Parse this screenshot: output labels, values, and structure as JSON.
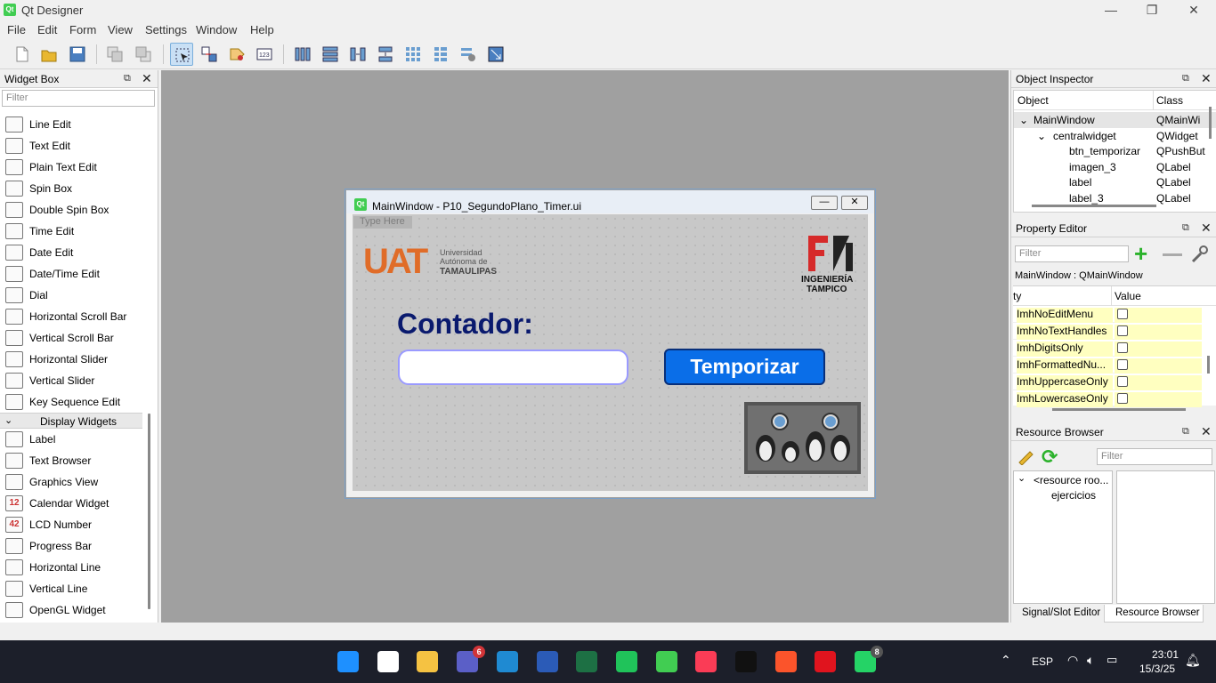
{
  "app": {
    "title": "Qt Designer",
    "icon": "qt-logo-icon"
  },
  "menu": [
    "File",
    "Edit",
    "Form",
    "View",
    "Settings",
    "Window",
    "Help"
  ],
  "widget_box": {
    "title": "Widget Box",
    "filter_placeholder": "Filter",
    "items": [
      {
        "label": "Line Edit",
        "icon": "line-edit-icon"
      },
      {
        "label": "Text Edit",
        "icon": "text-edit-icon"
      },
      {
        "label": "Plain Text Edit",
        "icon": "plain-text-edit-icon"
      },
      {
        "label": "Spin Box",
        "icon": "spin-box-icon"
      },
      {
        "label": "Double Spin Box",
        "icon": "double-spin-box-icon"
      },
      {
        "label": "Time Edit",
        "icon": "clock-icon"
      },
      {
        "label": "Date Edit",
        "icon": "calendar-icon"
      },
      {
        "label": "Date/Time Edit",
        "icon": "datetime-icon"
      },
      {
        "label": "Dial",
        "icon": "dial-icon"
      },
      {
        "label": "Horizontal Scroll Bar",
        "icon": "hscrollbar-icon"
      },
      {
        "label": "Vertical Scroll Bar",
        "icon": "vscrollbar-icon"
      },
      {
        "label": "Horizontal Slider",
        "icon": "hslider-icon"
      },
      {
        "label": "Vertical Slider",
        "icon": "vslider-icon"
      },
      {
        "label": "Key Sequence Edit",
        "icon": "key-sequence-icon"
      }
    ],
    "category": "Display Widgets",
    "display_items": [
      {
        "label": "Label",
        "icon": "label-tag-icon"
      },
      {
        "label": "Text Browser",
        "icon": "text-browser-icon"
      },
      {
        "label": "Graphics View",
        "icon": "graphics-view-icon"
      },
      {
        "label": "Calendar Widget",
        "icon": "calendar-widget-icon",
        "glyph": "12"
      },
      {
        "label": "LCD Number",
        "icon": "lcd-number-icon",
        "glyph": "42"
      },
      {
        "label": "Progress Bar",
        "icon": "progress-bar-icon"
      },
      {
        "label": "Horizontal Line",
        "icon": "hline-icon"
      },
      {
        "label": "Vertical Line",
        "icon": "vline-icon"
      },
      {
        "label": "OpenGL Widget",
        "icon": "opengl-icon"
      }
    ]
  },
  "form_window": {
    "title": "MainWindow - P10_SegundoPlano_Timer.ui",
    "type_here": "Type Here",
    "uat_logo": {
      "big": "UAT",
      "lines": [
        "Universidad",
        "Autónoma de",
        "TAMAULIPAS"
      ]
    },
    "fi_logo": {
      "lines": [
        "INGENIERÍA",
        "TAMPICO"
      ]
    },
    "contador_label": "Contador:",
    "line_edit_value": "",
    "button_label": "Temporizar"
  },
  "object_inspector": {
    "title": "Object Inspector",
    "columns": [
      "Object",
      "Class"
    ],
    "rows": [
      {
        "object": "MainWindow",
        "class": "QMainWi",
        "level": 0,
        "expander": "⌄"
      },
      {
        "object": "centralwidget",
        "class": "QWidget",
        "level": 1,
        "expander": "⌄"
      },
      {
        "object": "btn_temporizar",
        "class": "QPushBut",
        "level": 2,
        "expander": ""
      },
      {
        "object": "imagen_3",
        "class": "QLabel",
        "level": 2,
        "expander": ""
      },
      {
        "object": "label",
        "class": "QLabel",
        "level": 2,
        "expander": ""
      },
      {
        "object": "label_3",
        "class": "QLabel",
        "level": 2,
        "expander": ""
      }
    ]
  },
  "property_editor": {
    "title": "Property Editor",
    "filter_placeholder": "Filter",
    "context": "MainWindow : QMainWindow",
    "columns": [
      "ty",
      "Value"
    ],
    "rows": [
      {
        "name": "ImhNoEditMenu",
        "checked": false
      },
      {
        "name": "ImhNoTextHandles",
        "checked": false
      },
      {
        "name": "ImhDigitsOnly",
        "checked": false
      },
      {
        "name": "ImhFormattedNu...",
        "checked": false
      },
      {
        "name": "ImhUppercaseOnly",
        "checked": false
      },
      {
        "name": "ImhLowercaseOnly",
        "checked": false
      }
    ]
  },
  "resource_browser": {
    "title": "Resource Browser",
    "filter_placeholder": "Filter",
    "tree": [
      "<resource roo...",
      "ejercicios"
    ]
  },
  "bottom_tabs": [
    "Signal/Slot Editor",
    "Resource Browser"
  ],
  "taskbar": {
    "apps": [
      {
        "name": "windows-start-icon",
        "color": "#1e90ff"
      },
      {
        "name": "search-icon",
        "color": "#ffffff"
      },
      {
        "name": "file-explorer-icon",
        "color": "#f5c242"
      },
      {
        "name": "teams-icon",
        "color": "#5b5fc7",
        "badge": "6"
      },
      {
        "name": "vscode-icon",
        "color": "#1f8ad2"
      },
      {
        "name": "word-icon",
        "color": "#2b5bb7"
      },
      {
        "name": "excel-icon",
        "color": "#1d7044"
      },
      {
        "name": "pycharm-icon",
        "color": "#20c35a"
      },
      {
        "name": "qt-designer-icon",
        "color": "#41cd52"
      },
      {
        "name": "apple-music-icon",
        "color": "#fa3c56"
      },
      {
        "name": "apple-tv-icon",
        "color": "#111111"
      },
      {
        "name": "brave-icon",
        "color": "#fb542b"
      },
      {
        "name": "opera-icon",
        "color": "#e0141e"
      },
      {
        "name": "whatsapp-icon",
        "color": "#25d366",
        "badge": "8"
      }
    ],
    "lang": "ESP",
    "time": "23:01",
    "date": "15/3/25"
  }
}
